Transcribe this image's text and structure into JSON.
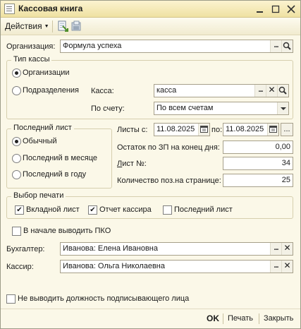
{
  "window": {
    "title": "Кассовая книга",
    "title_icon": "ledger-icon",
    "controls": [
      "minimize-icon",
      "restore-icon",
      "close-icon"
    ]
  },
  "toolbar": {
    "actions_label": "Действия",
    "tools": [
      "fill-document-icon",
      "print-settings-icon"
    ]
  },
  "organization": {
    "label": "Организация:",
    "value": "Формула успеха"
  },
  "cash_type": {
    "title": "Тип кассы",
    "options": [
      "Организации",
      "Подразделения"
    ],
    "selected": 0,
    "kassa_label": "Касса:",
    "kassa_value": "касса",
    "account_label": "По счету:",
    "account_value": "По всем счетам"
  },
  "last_sheet": {
    "title": "Последний лист",
    "options": [
      "Обычный",
      "Последний в месяце",
      "Последний в году"
    ],
    "selected": 0
  },
  "sheets": {
    "from_label": "Листы с:",
    "from_value": "11.08.2025",
    "to_label": "по:",
    "to_value": "11.08.2025",
    "period_button": "..."
  },
  "balance": {
    "label": "Остаток по ЗП на конец дня:",
    "value": "0,00"
  },
  "sheet_no": {
    "label_prefix": "Л",
    "label_rest": "ист №:",
    "value": "34"
  },
  "count": {
    "label": "Количество поз.на странице:",
    "value": "25"
  },
  "print_choice": {
    "title": "Выбор печати",
    "items": [
      {
        "label": "Вкладной лист",
        "checked": true
      },
      {
        "label": "Отчет кассира",
        "checked": true
      },
      {
        "label": "Последний лист",
        "checked": false
      }
    ]
  },
  "pko": {
    "label": "В начале выводить ПКО",
    "checked": false
  },
  "accountant": {
    "label": "Бухгалтер:",
    "value": "Иванова: Елена Ивановна"
  },
  "cashier": {
    "label": "Кассир:",
    "value": "Иванова: Ольга Николаевна"
  },
  "no_position": {
    "label": "Не выводить должность подписывающего лица",
    "checked": false
  },
  "footer": {
    "ok": "OK",
    "print": "Печать",
    "close": "Закрыть"
  },
  "colors": {
    "window_bg": "#fbf8e8",
    "title_bg": "#efe1a2",
    "accent_green": "#4f8f2a"
  }
}
